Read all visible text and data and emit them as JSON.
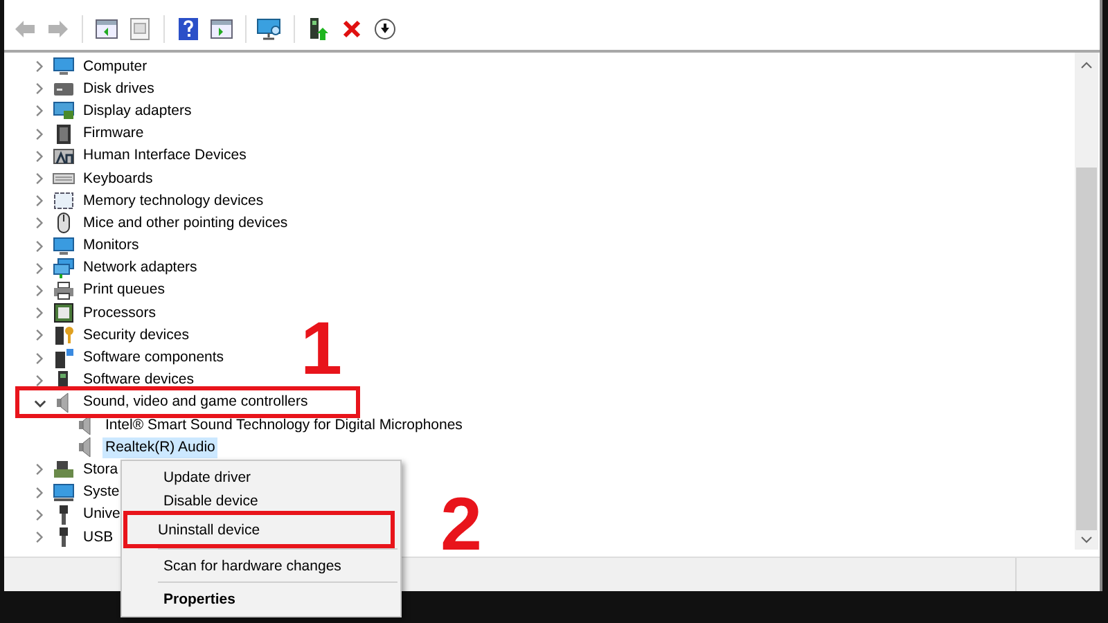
{
  "toolbar": {
    "buttons": [
      {
        "kind": "back",
        "disabled": true
      },
      {
        "kind": "forward",
        "disabled": true
      },
      {
        "kind": "sep"
      },
      {
        "kind": "pane"
      },
      {
        "kind": "sheet"
      },
      {
        "kind": "sep"
      },
      {
        "kind": "help"
      },
      {
        "kind": "pane2"
      },
      {
        "kind": "sep"
      },
      {
        "kind": "scan"
      },
      {
        "kind": "sep"
      },
      {
        "kind": "driver"
      },
      {
        "kind": "remove"
      },
      {
        "kind": "down"
      }
    ]
  },
  "tree": {
    "items": [
      {
        "label": "Computer",
        "expanded": false,
        "selected": false
      },
      {
        "label": "Disk drives",
        "expanded": false,
        "selected": false
      },
      {
        "label": "Display adapters",
        "expanded": false,
        "selected": false
      },
      {
        "label": "Firmware",
        "expanded": false,
        "selected": false
      },
      {
        "label": "Human Interface Devices",
        "expanded": false,
        "selected": false
      },
      {
        "label": "Keyboards",
        "expanded": false,
        "selected": false
      },
      {
        "label": "Memory technology devices",
        "expanded": false,
        "selected": false
      },
      {
        "label": "Mice and other pointing devices",
        "expanded": false,
        "selected": false
      },
      {
        "label": "Monitors",
        "expanded": false,
        "selected": false
      },
      {
        "label": "Network adapters",
        "expanded": false,
        "selected": false
      },
      {
        "label": "Print queues",
        "expanded": false,
        "selected": false
      },
      {
        "label": "Processors",
        "expanded": false,
        "selected": false
      },
      {
        "label": "Security devices",
        "expanded": false,
        "selected": false
      },
      {
        "label": "Software components",
        "expanded": false,
        "selected": false
      },
      {
        "label": "Software devices",
        "expanded": false,
        "selected": false
      },
      {
        "label": "Sound, video and game controllers",
        "expanded": true,
        "selected": false,
        "callout": "1",
        "children": [
          {
            "label": "Intel® Smart Sound Technology for Digital Microphones",
            "selected": false
          },
          {
            "label": "Realtek(R) Audio",
            "selected": true
          }
        ]
      },
      {
        "label": "Stora",
        "expanded": false,
        "selected": false
      },
      {
        "label": "Syste",
        "expanded": false,
        "selected": false
      },
      {
        "label": "Unive",
        "expanded": false,
        "selected": false
      },
      {
        "label": "USB",
        "expanded": false,
        "selected": false
      }
    ]
  },
  "context_menu": {
    "items": [
      {
        "kind": "item",
        "label": "Update driver"
      },
      {
        "kind": "item",
        "label": "Disable device"
      },
      {
        "kind": "item",
        "label": "Uninstall device",
        "callout": "2"
      },
      {
        "kind": "separator"
      },
      {
        "kind": "item",
        "label": "Scan for hardware changes"
      },
      {
        "kind": "separator"
      },
      {
        "kind": "default",
        "label": "Properties"
      }
    ]
  }
}
